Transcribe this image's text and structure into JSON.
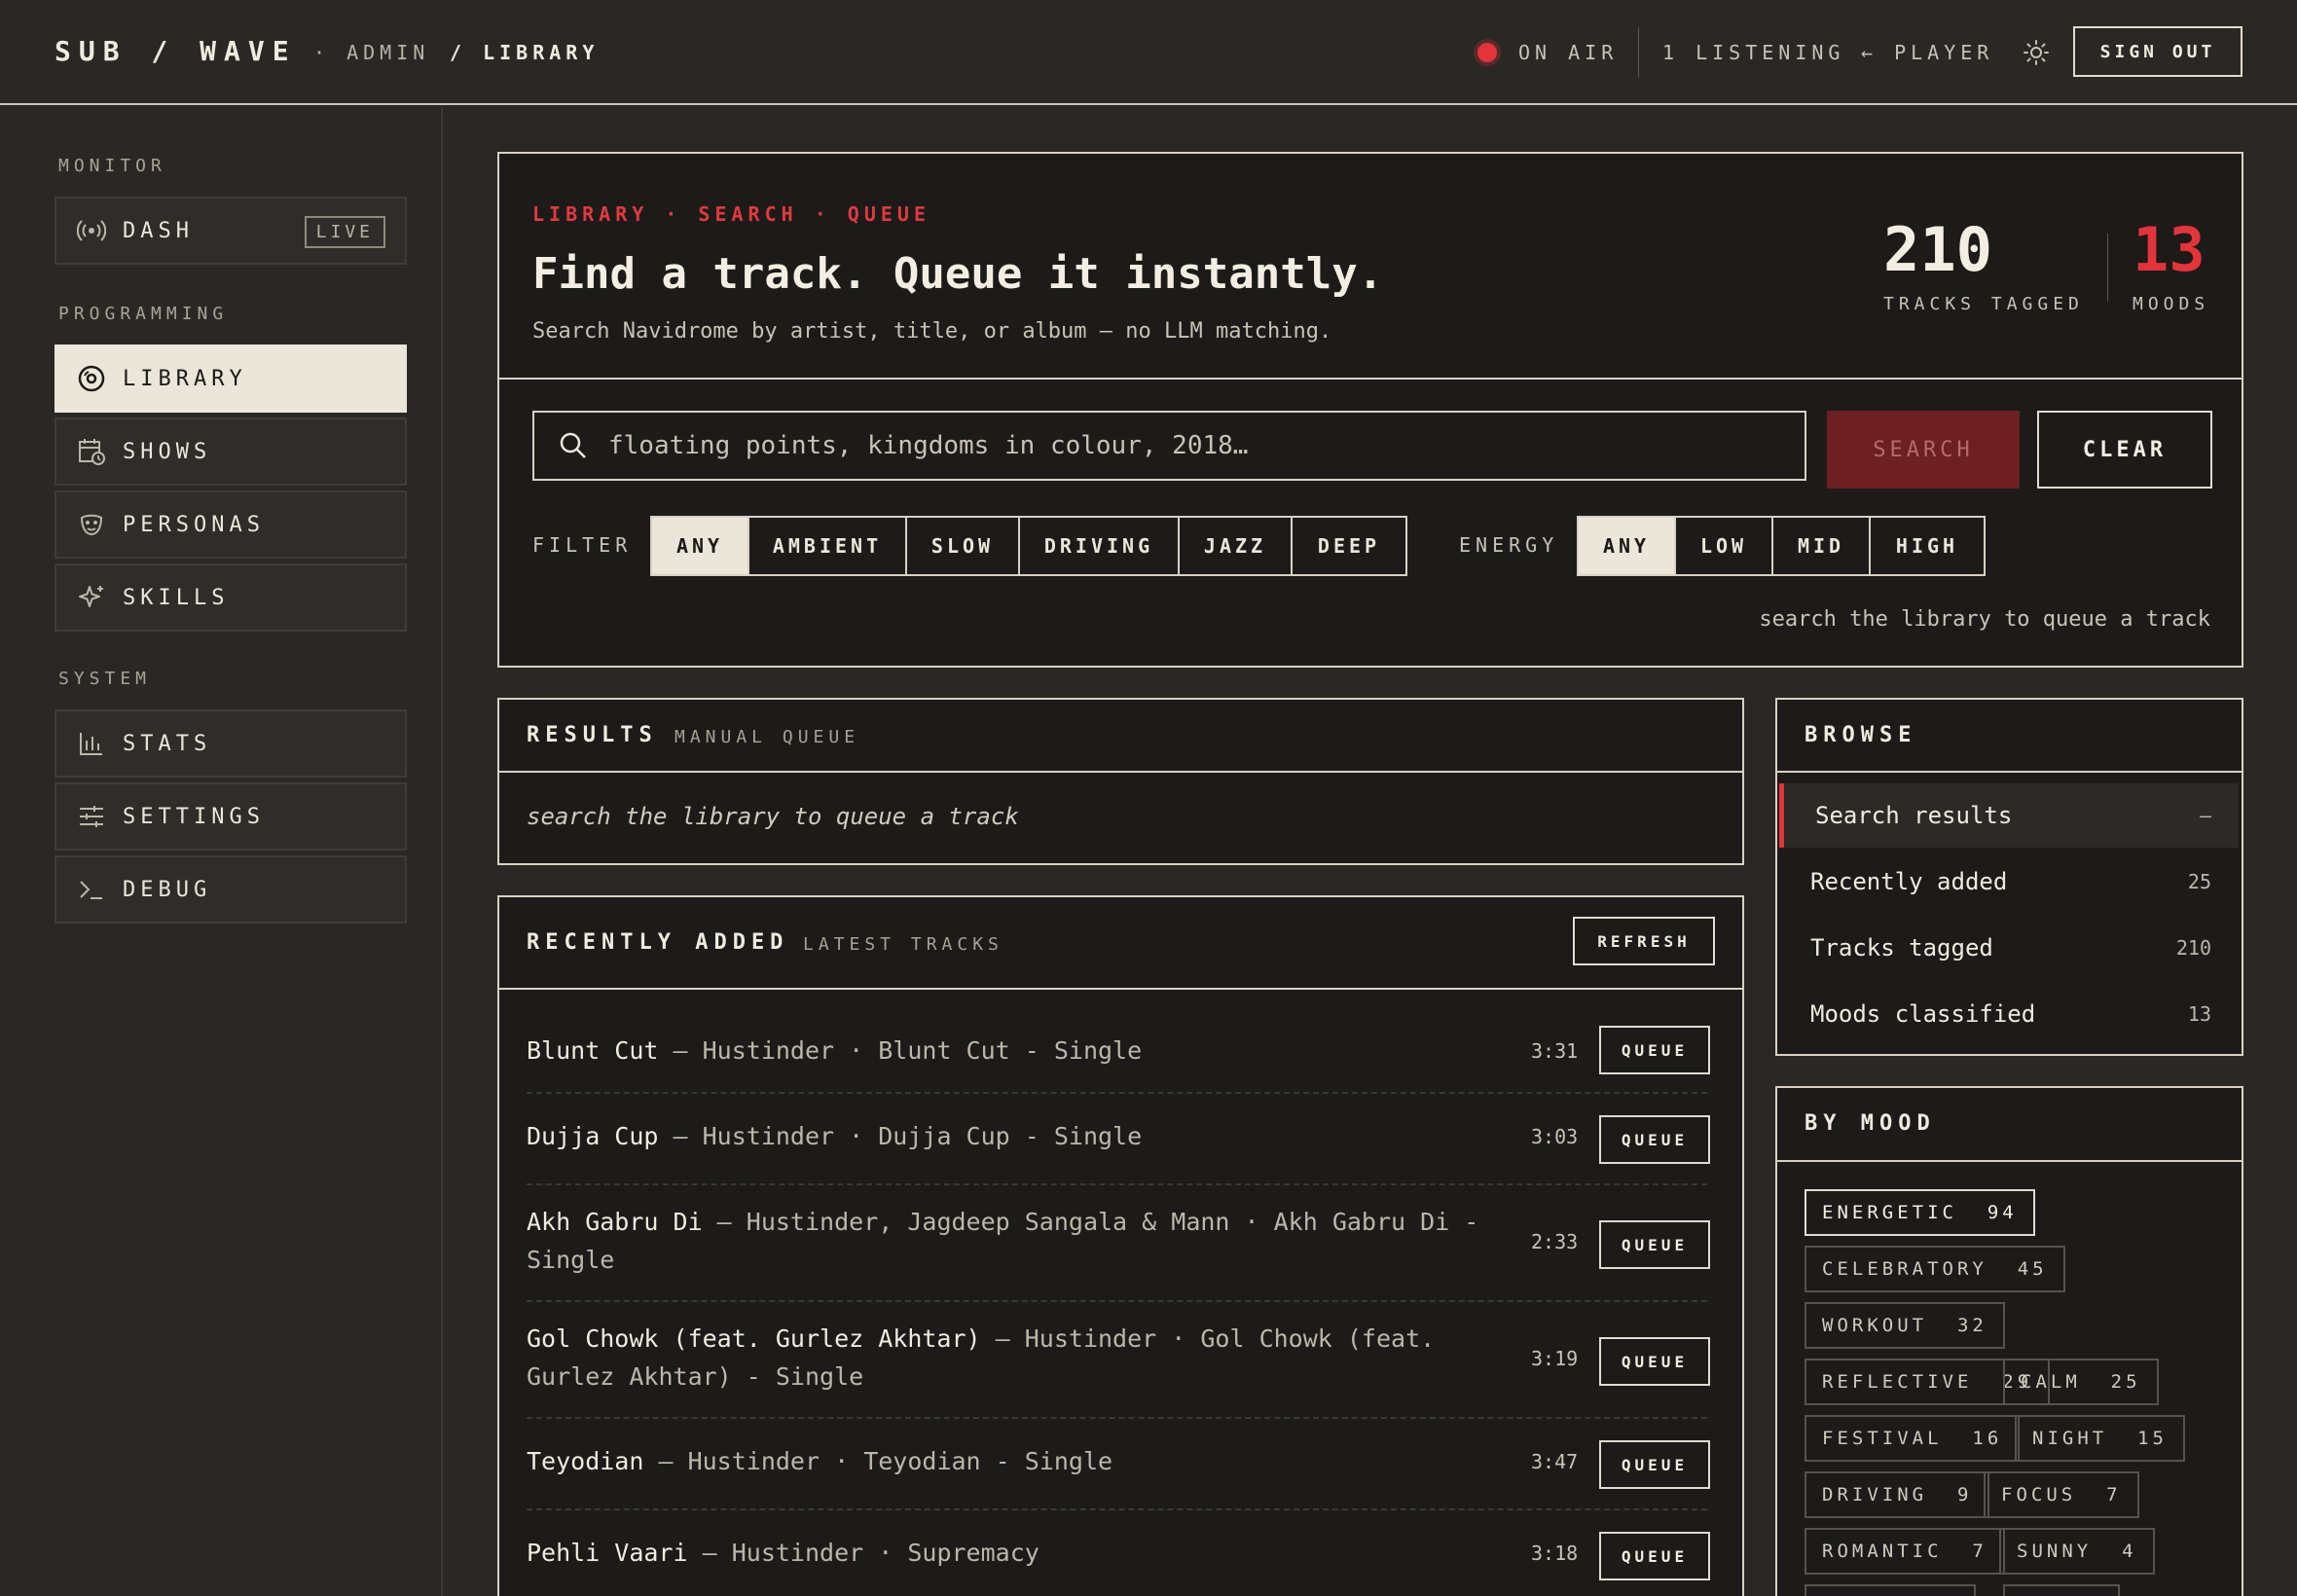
{
  "topbar": {
    "brand": "SUB / WAVE",
    "crumb_admin": "· ADMIN",
    "crumb_library": "/ LIBRARY",
    "on_air": "ON AIR",
    "listening": "1 LISTENING",
    "player": "← PLAYER",
    "sign_out": "SIGN OUT",
    "accent": "#e3343a"
  },
  "sidebar": {
    "sections": {
      "monitor": "MONITOR",
      "programming": "PROGRAMMING",
      "system": "SYSTEM"
    },
    "dash": {
      "label": "DASH",
      "badge": "LIVE",
      "icon": "broadcast-icon"
    },
    "items": [
      {
        "label": "LIBRARY",
        "icon": "disc-icon",
        "active": true
      },
      {
        "label": "SHOWS",
        "icon": "calendar-clock-icon"
      },
      {
        "label": "PERSONAS",
        "icon": "mask-icon"
      },
      {
        "label": "SKILLS",
        "icon": "sparkle-icon"
      },
      {
        "label": "STATS",
        "icon": "bar-chart-icon"
      },
      {
        "label": "SETTINGS",
        "icon": "sliders-icon"
      },
      {
        "label": "DEBUG",
        "icon": "terminal-icon"
      }
    ]
  },
  "hero": {
    "kicker": "LIBRARY · SEARCH · QUEUE",
    "title": "Find a track. Queue it instantly.",
    "subtitle": "Search Navidrome by artist, title, or album — no LLM matching.",
    "stats": [
      {
        "value": "210",
        "label": "TRACKS TAGGED"
      },
      {
        "value": "13",
        "label": "MOODS"
      }
    ]
  },
  "search": {
    "placeholder": "floating points, kingdoms in colour, 2018…",
    "value": "",
    "search_label": "SEARCH",
    "clear_label": "CLEAR",
    "filter_label": "FILTER",
    "filters": [
      "ANY",
      "AMBIENT",
      "SLOW",
      "DRIVING",
      "JAZZ",
      "DEEP"
    ],
    "filter_selected": "ANY",
    "energy_label": "ENERGY",
    "energies": [
      "ANY",
      "LOW",
      "MID",
      "HIGH"
    ],
    "energy_selected": "ANY",
    "hint": "search the library to queue a track"
  },
  "results": {
    "title": "RESULTS",
    "subtitle": "MANUAL QUEUE",
    "empty": "search the library to queue a track"
  },
  "recent": {
    "title": "RECENTLY ADDED",
    "subtitle": "LATEST TRACKS",
    "refresh_label": "REFRESH",
    "queue_label": "QUEUE",
    "tracks": [
      {
        "title": "Blunt Cut",
        "meta": " — Hustinder · Blunt Cut - Single",
        "duration": "3:31"
      },
      {
        "title": "Dujja Cup",
        "meta": " — Hustinder · Dujja Cup - Single",
        "duration": "3:03"
      },
      {
        "title": "Akh Gabru Di",
        "meta": " — Hustinder, Jagdeep Sangala & Mann · Akh Gabru Di - Single",
        "duration": "2:33"
      },
      {
        "title": "Gol Chowk (feat. Gurlez Akhtar)",
        "meta": " — Hustinder · Gol Chowk (feat. Gurlez Akhtar) - Single",
        "duration": "3:19"
      },
      {
        "title": "Teyodian",
        "meta": " — Hustinder · Teyodian - Single",
        "duration": "3:47"
      },
      {
        "title": "Pehli Vaari",
        "meta": " — Hustinder · Supremacy",
        "duration": "3:18"
      }
    ]
  },
  "browse": {
    "title": "BROWSE",
    "items": [
      {
        "label": "Search results",
        "count": "—",
        "active": true
      },
      {
        "label": "Recently added",
        "count": "25"
      },
      {
        "label": "Tracks tagged",
        "count": "210"
      },
      {
        "label": "Moods classified",
        "count": "13"
      }
    ]
  },
  "moods": {
    "title": "BY MOOD",
    "chips": [
      {
        "label": "ENERGETIC",
        "count": "94",
        "active": true
      },
      {
        "label": "CELEBRATORY",
        "count": "45"
      },
      {
        "label": "WORKOUT",
        "count": "32"
      },
      {
        "label": "REFLECTIVE",
        "count": "29"
      },
      {
        "label": "CALM",
        "count": "25"
      },
      {
        "label": "FESTIVAL",
        "count": "16"
      },
      {
        "label": "NIGHT",
        "count": "15"
      },
      {
        "label": "DRIVING",
        "count": "9"
      },
      {
        "label": "FOCUS",
        "count": "7"
      },
      {
        "label": "ROMANTIC",
        "count": "7"
      },
      {
        "label": "SUNNY",
        "count": "4"
      }
    ]
  }
}
